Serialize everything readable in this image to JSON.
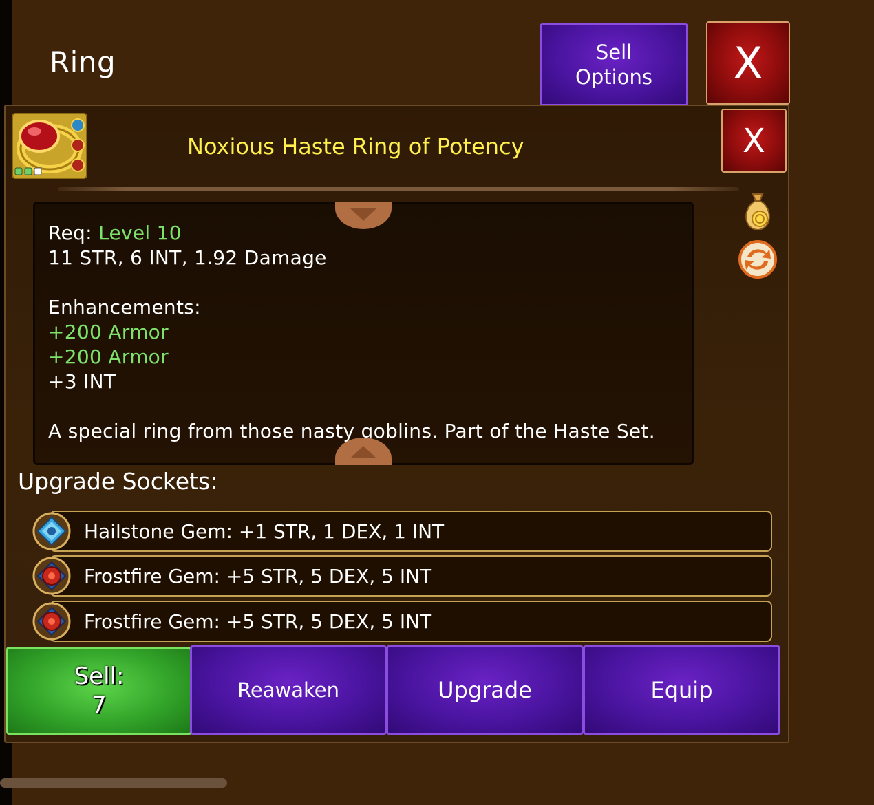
{
  "window": {
    "title": "Ring"
  },
  "header": {
    "sell_options_label": "Sell\nOptions",
    "close_label": "X"
  },
  "item": {
    "name": "Noxious Haste Ring of Potency",
    "close_label": "X",
    "req_label": "Req:",
    "req_value": "Level 10",
    "stats": "11 STR, 6 INT, 1.92 Damage",
    "enhancements_title": "Enhancements:",
    "enhancements": [
      "+200 Armor",
      "+200 Armor",
      "+3 INT"
    ],
    "description": "A special ring from those nasty goblins. Part of the Haste Set."
  },
  "sockets": {
    "title": "Upgrade Sockets:",
    "items": [
      {
        "text": "Hailstone Gem: +1 STR, 1 DEX, 1 INT",
        "gem": "blue-gem-icon"
      },
      {
        "text": "Frostfire Gem: +5 STR, 5 DEX, 5 INT",
        "gem": "red-gem-icon"
      },
      {
        "text": "Frostfire Gem: +5 STR, 5 DEX, 5 INT",
        "gem": "red-gem-icon"
      }
    ]
  },
  "actions": {
    "sell_label": "Sell:",
    "sell_price": "7",
    "reawaken_label": "Reawaken",
    "upgrade_label": "Upgrade",
    "equip_label": "Equip"
  },
  "colors": {
    "background": "#3f2409",
    "item_name": "#fff04e",
    "highlight_green": "#7de16a",
    "button_purple": "#4a14a0",
    "button_red": "#8d0c0c",
    "button_green": "#33a52a"
  }
}
